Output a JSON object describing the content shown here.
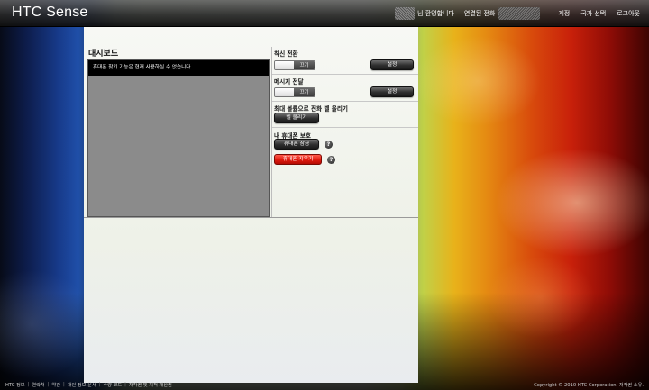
{
  "header": {
    "logo": "HTC Sense",
    "welcome": "님 환영합니다",
    "connected_phone_label": "연결된 전화",
    "nav": [
      "계정",
      "국가 선택",
      "로그아웃"
    ]
  },
  "dashboard": {
    "title": "대시보드",
    "message": "휴대폰 찾기 기능은 현재 사용하실 수 없습니다."
  },
  "ring_mode": {
    "title": "착신 전환",
    "toggle_state": "끄기",
    "settings_button": "설정"
  },
  "message_forward": {
    "title": "메시지 전달",
    "toggle_state": "끄기",
    "settings_button": "설정"
  },
  "ring_loud": {
    "title": "최대 볼륨으로 전화 벨 울리기",
    "button": "벨 울리기"
  },
  "protect": {
    "title": "내 휴대폰 보호",
    "lock_button": "휴대폰 잠금",
    "wipe_button": "휴대폰 지우기",
    "help_glyph": "?"
  },
  "footer": {
    "links": [
      "HTC 정보",
      "연락처",
      "약관",
      "개인 정보 문서",
      "수량 코드",
      "저작권 및 지적 재산권"
    ],
    "copyright": "Copyright © 2010 HTC Corporation. 저작권 소유."
  },
  "colors": {
    "accent_red": "#e01a0e",
    "header_bg": "#2f2f2f",
    "dashboard_box": "#8b8b8b"
  }
}
